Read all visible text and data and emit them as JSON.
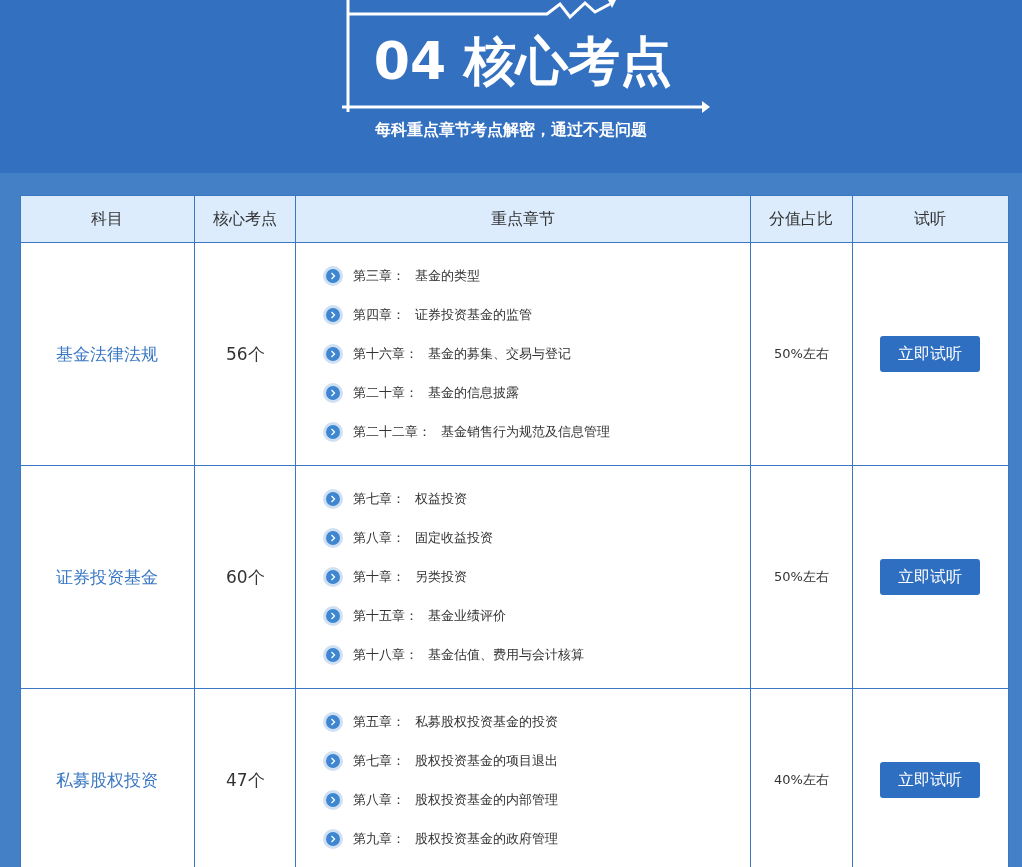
{
  "header": {
    "title": "04 核心考点",
    "subtitle": "每科重点章节考点解密，通过不是问题"
  },
  "table": {
    "columns": [
      "科目",
      "核心考点",
      "重点章节",
      "分值占比",
      "试听"
    ],
    "rows": [
      {
        "subject": "基金法律法规",
        "count": "56个",
        "chapters": [
          {
            "number": "第三章：",
            "name": "基金的类型"
          },
          {
            "number": "第四章：",
            "name": "证券投资基金的监管"
          },
          {
            "number": "第十六章：",
            "name": "基金的募集、交易与登记"
          },
          {
            "number": "第二十章：",
            "name": "基金的信息披露"
          },
          {
            "number": "第二十二章：",
            "name": "基金销售行为规范及信息管理"
          }
        ],
        "share": "50%左右",
        "button": "立即试听"
      },
      {
        "subject": "证券投资基金",
        "count": "60个",
        "chapters": [
          {
            "number": "第七章：",
            "name": "权益投资"
          },
          {
            "number": "第八章：",
            "name": "固定收益投资"
          },
          {
            "number": "第十章：",
            "name": "另类投资"
          },
          {
            "number": "第十五章：",
            "name": "基金业绩评价"
          },
          {
            "number": "第十八章：",
            "name": "基金估值、费用与会计核算"
          }
        ],
        "share": "50%左右",
        "button": "立即试听"
      },
      {
        "subject": "私募股权投资",
        "count": "47个",
        "chapters": [
          {
            "number": "第五章：",
            "name": "私募股权投资基金的投资"
          },
          {
            "number": "第七章：",
            "name": "股权投资基金的项目退出"
          },
          {
            "number": "第八章：",
            "name": "股权投资基金的内部管理"
          },
          {
            "number": "第九章：",
            "name": "股权投资基金的政府管理"
          }
        ],
        "share": "40%左右",
        "button": "立即试听"
      }
    ]
  }
}
